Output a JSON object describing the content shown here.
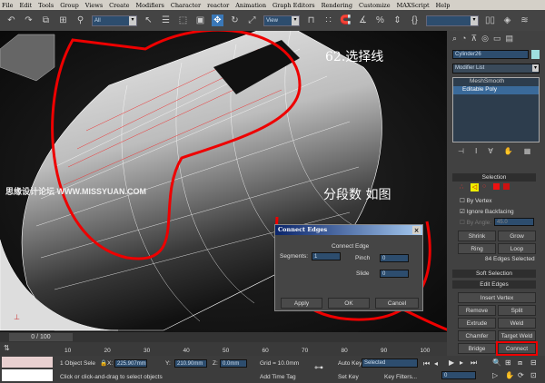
{
  "menu": [
    "File",
    "Edit",
    "Tools",
    "Group",
    "Views",
    "Create",
    "Modifiers",
    "Character",
    "reactor",
    "Animation",
    "Graph Editors",
    "Rendering",
    "Customize",
    "MAXScript",
    "Help"
  ],
  "toolbar": {
    "selection_filter": "All",
    "reference_coord": "View"
  },
  "viewport": {
    "annotation_step": "62.选择线",
    "annotation_segments": "分段数 如图",
    "watermark": "思缘设计论坛 WWW.MISSYUAN.COM"
  },
  "command_panel": {
    "object_name": "Cylinder26",
    "object_color": "#9fe0e0",
    "modifier_list": "Modifier List",
    "stack": [
      "MeshSmooth",
      "Editable Poly"
    ],
    "selection": {
      "title": "Selection",
      "by_vertex": "By Vertex",
      "ignore_backfacing": "Ignore Backfacing",
      "by_angle": "By Angle:",
      "angle_value": "45.0",
      "shrink": "Shrink",
      "grow": "Grow",
      "ring": "Ring",
      "loop": "Loop",
      "status": "84 Edges Selected"
    },
    "soft_selection": "Soft Selection",
    "edit_edges": {
      "title": "Edit Edges",
      "insert_vertex": "Insert Vertex",
      "remove": "Remove",
      "split": "Split",
      "extrude": "Extrude",
      "weld": "Weld",
      "chamfer": "Chamfer",
      "target_weld": "Target Weld",
      "bridge": "Bridge",
      "connect": "Connect"
    }
  },
  "dialog": {
    "title": "Connect Edges",
    "group": "Connect Edge",
    "segments_label": "Segments:",
    "segments": "1",
    "pinch_label": "Pinch",
    "pinch": "0",
    "slide_label": "Slide",
    "slide": "0",
    "apply": "Apply",
    "ok": "OK",
    "cancel": "Cancel"
  },
  "timeline": {
    "frame": "0 / 100",
    "ticks": [
      "10",
      "20",
      "30",
      "40",
      "50",
      "60",
      "70",
      "80",
      "90",
      "100"
    ]
  },
  "status": {
    "selection": "1 Object Sele",
    "x_label": "X:",
    "x": "225.907mm",
    "y_label": "Y:",
    "y": "210.90mm",
    "z_label": "Z:",
    "z": "0.0mm",
    "grid": "Grid = 10.0mm",
    "add_time_tag": "Add Time Tag",
    "prompt": "Click or click-and-drag to select objects",
    "auto_key": "Auto Key",
    "key_mode": "Selected",
    "set_key": "Set Key",
    "key_filters": "Key Filters...",
    "current_frame": "0"
  }
}
